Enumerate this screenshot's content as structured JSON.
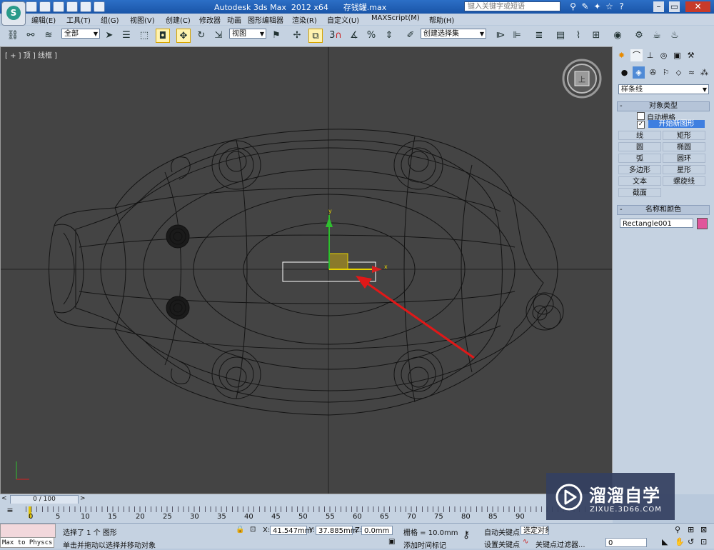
{
  "title_bar": {
    "app_title": "Autodesk 3ds Max  2012 x64",
    "file_name": "存钱罐.max",
    "search_placeholder": "键入关键字或短语"
  },
  "menu": {
    "items": [
      "编辑(E)",
      "工具(T)",
      "组(G)",
      "视图(V)",
      "创建(C)",
      "修改器",
      "动画",
      "图形编辑器",
      "渲染(R)",
      "自定义(U)",
      "MAXScript(M)",
      "帮助(H)"
    ]
  },
  "toolbar": {
    "selection_filter": "全部",
    "reference_coord": "视图",
    "snap_label": "3",
    "named_selection": "创建选择集"
  },
  "viewport": {
    "label": "[ + ] 顶 ] 线框 ]",
    "gizmo_x": "x",
    "gizmo_y": "y",
    "viewcube_label": "上"
  },
  "command_panel": {
    "category": "样条线",
    "object_type_header": "对象类型",
    "auto_grid_label": "自动栅格",
    "auto_grid_checked": false,
    "start_new_shape_checked": true,
    "start_new_shape_label": "开始新图形",
    "shape_buttons": [
      "线",
      "矩形",
      "圆",
      "椭圆",
      "弧",
      "圆环",
      "多边形",
      "星形",
      "文本",
      "螺旋线",
      "截面"
    ],
    "name_color_header": "名称和颜色",
    "object_name": "Rectangle001",
    "object_color": "#e0559a"
  },
  "timeline": {
    "frame_counter": "0 / 100",
    "ticks": [
      "0",
      "5",
      "10",
      "15",
      "20",
      "25",
      "30",
      "35",
      "40",
      "45",
      "50",
      "55",
      "60",
      "65",
      "70",
      "75",
      "80",
      "85",
      "90"
    ]
  },
  "status": {
    "maxscript_listener": "Max to Physcs (",
    "selection_msg": "选择了 1 个 图形",
    "prompt_msg": "单击并拖动以选择并移动对象",
    "x_label": "X:",
    "x_value": "41.547mm",
    "y_label": "Y:",
    "y_value": "37.885mm",
    "z_label": "Z:",
    "z_value": "0.0mm",
    "grid_label": "栅格 = 10.0mm",
    "auto_key": "自动关键点",
    "set_key": "设置关键点",
    "selected_dropdown": "选定对象",
    "key_filters": "关键点过滤器...",
    "add_time_tag": "添加时间标记",
    "frame_value": "0"
  },
  "watermark": {
    "brand": "溜溜自学",
    "url": "ZIXUE.3D66.COM"
  }
}
